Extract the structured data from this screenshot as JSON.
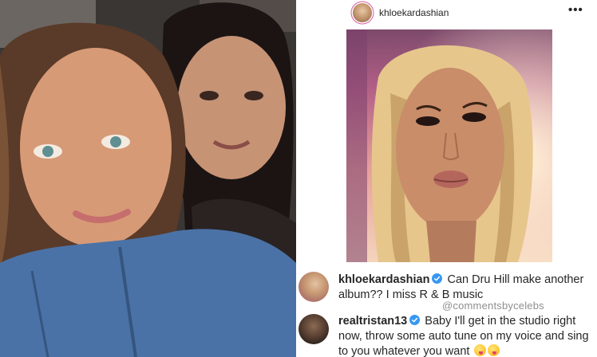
{
  "post": {
    "username": "khloekardashian",
    "more_icon": "more-options-icon",
    "image_subject": "selfie-portrait"
  },
  "left_image": {
    "subject": "two-women-selfie"
  },
  "comments": [
    {
      "username": "khloekardashian",
      "verified": true,
      "text": "Can Dru Hill make another album?? I miss R & B music"
    },
    {
      "username": "realtristan13",
      "verified": true,
      "text": "Baby I'll get in the studio right now, throw some auto tune on my voice and sing to you whatever you want",
      "emojis": [
        "winking-tongue-emoji",
        "winking-tongue-emoji"
      ]
    }
  ],
  "watermark": "@commentsbycelebs",
  "colors": {
    "verified_blue": "#3897f0",
    "text": "#262626",
    "muted": "#8e8e8e"
  }
}
